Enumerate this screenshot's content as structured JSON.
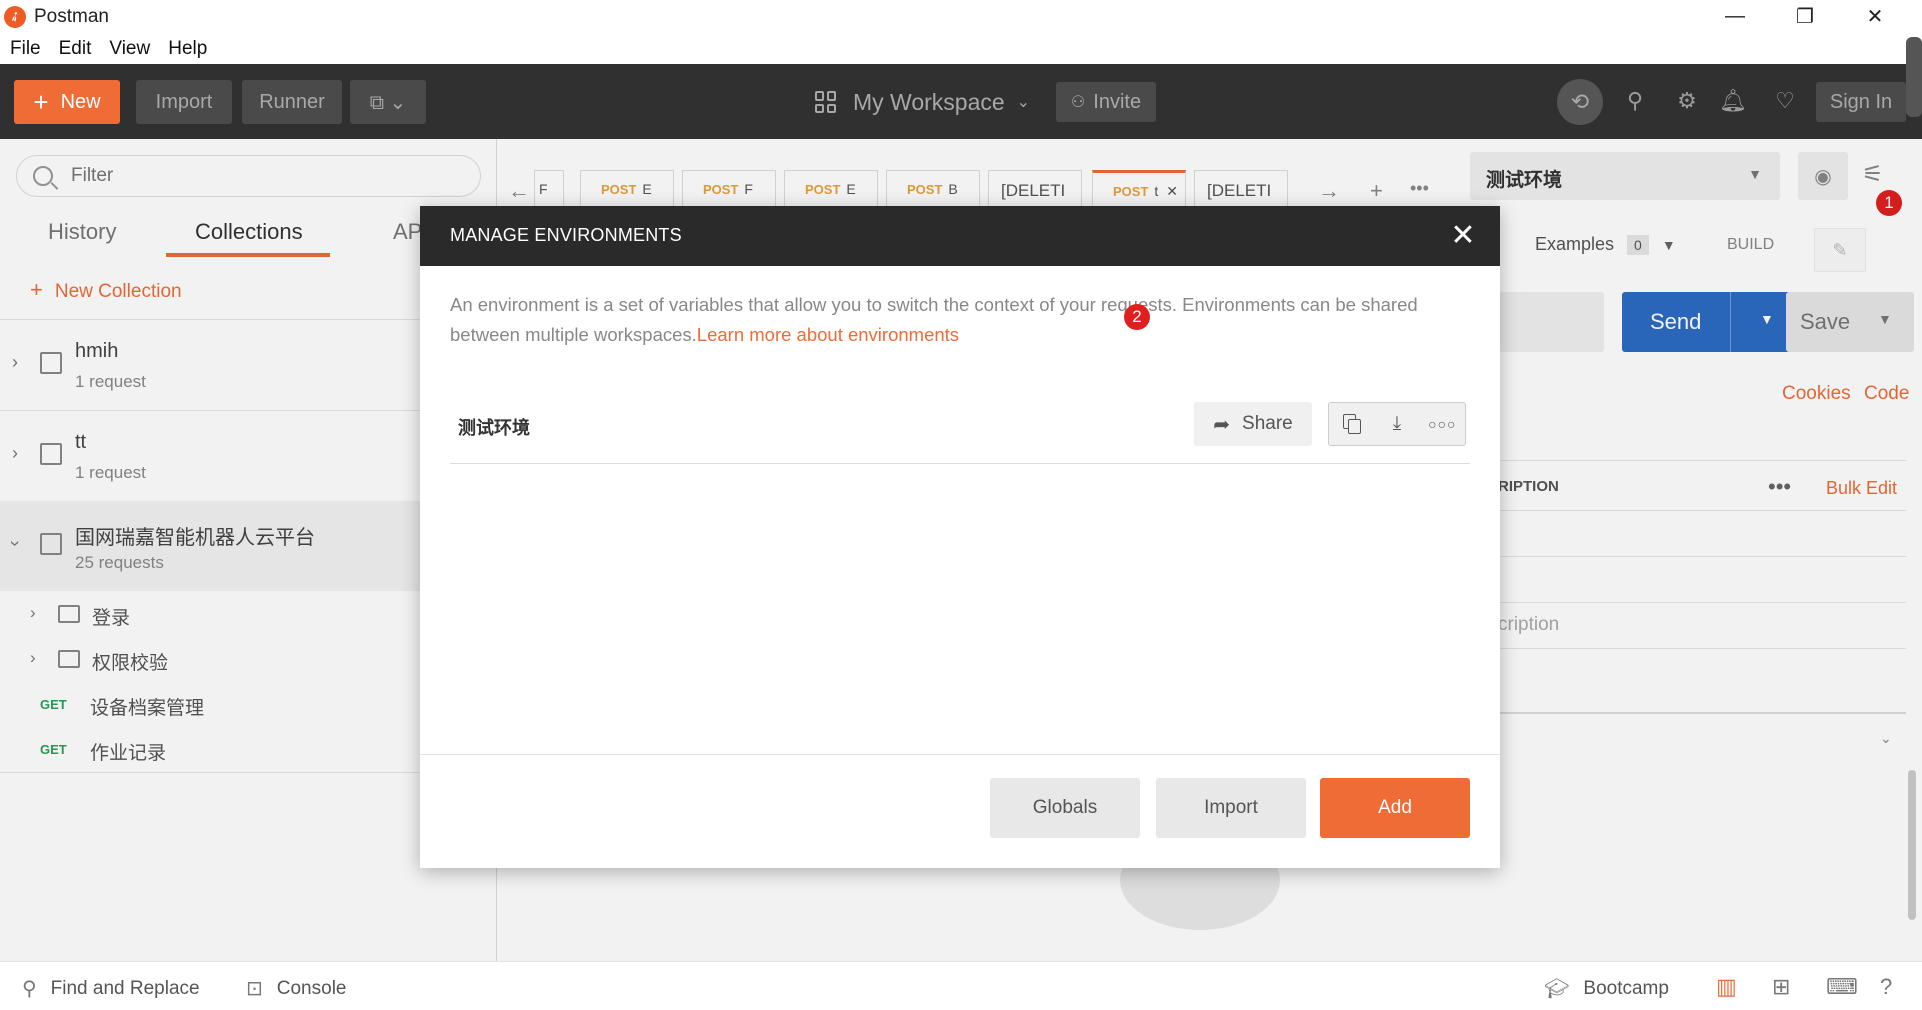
{
  "window": {
    "title": "Postman",
    "minimize": "—",
    "restore": "❐",
    "close": "✕"
  },
  "menu": [
    "File",
    "Edit",
    "View",
    "Help"
  ],
  "header": {
    "new_label": "New",
    "import_label": "Import",
    "runner_label": "Runner",
    "workspace_label": "My Workspace",
    "invite_label": "Invite",
    "signin_label": "Sign In"
  },
  "sidebar": {
    "filter_placeholder": "Filter",
    "tabs": [
      "History",
      "Collections",
      "AP"
    ],
    "new_collection": "New Collection",
    "collections": [
      {
        "name": "hmih",
        "count": "1 request"
      },
      {
        "name": "tt",
        "count": "1 request"
      },
      {
        "name": "国网瑞嘉智能机器人云平台",
        "count": "25 requests"
      }
    ],
    "folders": [
      "登录",
      "权限校验"
    ],
    "requests": [
      {
        "method": "GET",
        "name": "设备档案管理"
      },
      {
        "method": "GET",
        "name": "作业记录"
      }
    ]
  },
  "request_tabs": [
    {
      "method": "",
      "name": "F"
    },
    {
      "method": "POST",
      "name": "E"
    },
    {
      "method": "POST",
      "name": "F"
    },
    {
      "method": "POST",
      "name": "E"
    },
    {
      "method": "POST",
      "name": "B"
    },
    {
      "method": "",
      "name": "[DELETI"
    },
    {
      "method": "POST",
      "name": "t"
    },
    {
      "method": "",
      "name": "[DELETI"
    }
  ],
  "env_selector": {
    "value": "测试环境"
  },
  "request_area": {
    "examples_label": "Examples",
    "examples_count": "0",
    "build_label": "BUILD",
    "send_label": "Send",
    "save_label": "Save",
    "cookies_label": "Cookies",
    "code_label": "Code",
    "description_header": "RIPTION",
    "bulk_edit_label": "Bulk Edit",
    "description_placeholder": "cription"
  },
  "modal": {
    "title": "MANAGE ENVIRONMENTS",
    "description": "An environment is a set of variables that allow you to switch the context of your requests. Environments can be shared between multiple workspaces.",
    "learn_more": "Learn more about environments",
    "environments": [
      {
        "name": "测试环境"
      }
    ],
    "share_label": "Share",
    "globals_label": "Globals",
    "import_label": "Import",
    "add_label": "Add"
  },
  "badges": {
    "settings": "1",
    "download": "2"
  },
  "statusbar": {
    "find_replace": "Find and Replace",
    "console": "Console",
    "bootcamp": "Bootcamp"
  },
  "colors": {
    "accent": "#ef6c37",
    "send_blue": "#2c6cc4",
    "header_bg": "#303030",
    "badge_red": "#e0201f"
  }
}
